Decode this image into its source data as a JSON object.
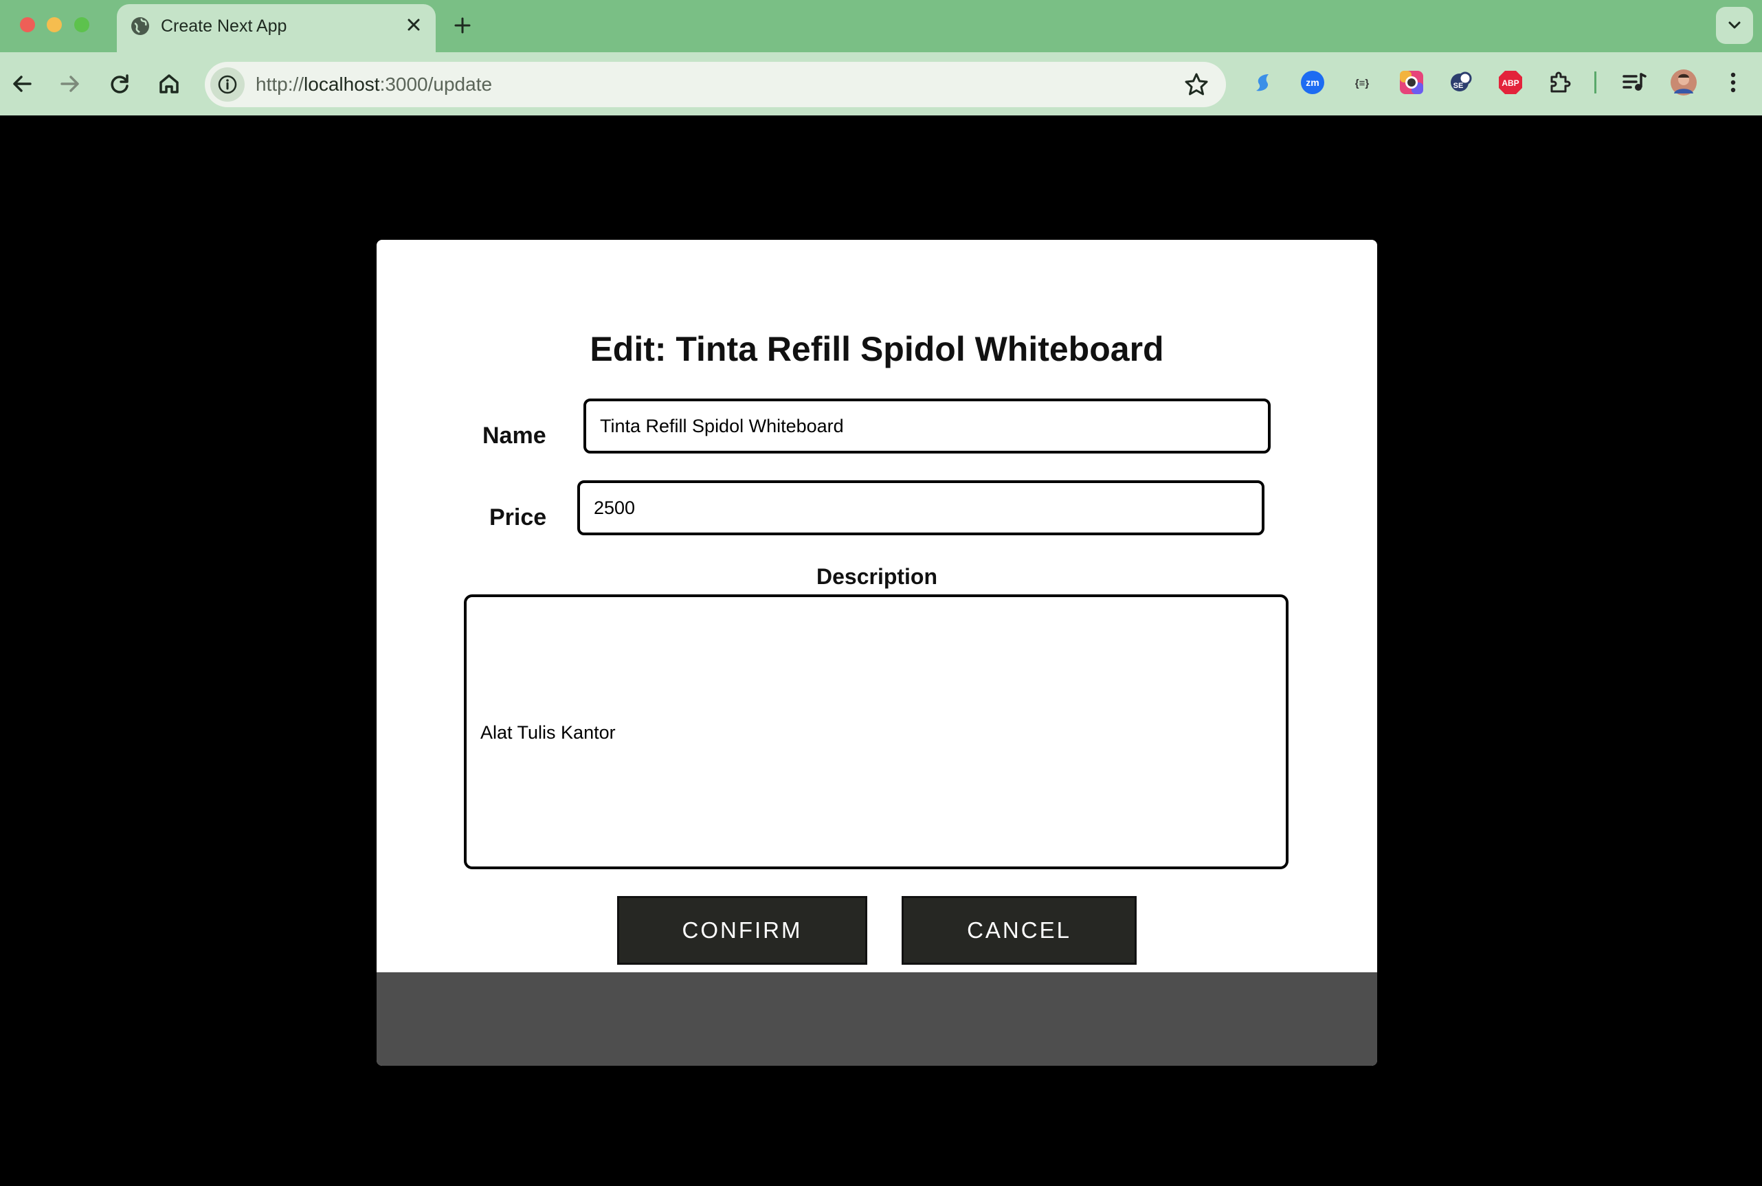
{
  "browser": {
    "tab": {
      "title": "Create Next App"
    },
    "address_bar": {
      "scheme": "http://",
      "host": "localhost",
      "rest": ":3000/update"
    },
    "extensions": [
      {
        "name": "swirl-extension-icon",
        "color": "#3b8fe8"
      },
      {
        "name": "zoom-extension-icon",
        "label": "zm",
        "color": "#1d6cf2"
      },
      {
        "name": "json-extension-icon",
        "label": "{≡}",
        "color": "#333333"
      },
      {
        "name": "color-picker-extension-icon",
        "color": "#e6447a"
      },
      {
        "name": "seo-extension-icon",
        "label": "SE",
        "color": "#2c3e6e"
      },
      {
        "name": "adblock-plus-icon",
        "label": "ABP",
        "color": "#e3233b"
      },
      {
        "name": "puzzle-extensions-icon",
        "color": "#222222"
      },
      {
        "name": "media-control-icon",
        "color": "#222222"
      },
      {
        "name": "profile-avatar",
        "color": "#c98a72"
      },
      {
        "name": "kebab-menu-icon",
        "color": "#222222"
      }
    ]
  },
  "modal": {
    "title": "Edit: Tinta Refill Spidol Whiteboard",
    "name_label": "Name",
    "name_value": "Tinta Refill Spidol Whiteboard",
    "price_label": "Price",
    "price_value": "2500",
    "description_label": "Description",
    "description_value": "Alat Tulis Kantor",
    "confirm_label": "CONFIRM",
    "cancel_label": "CANCEL"
  },
  "colors": {
    "tab_bar": "#7abf85",
    "toolbar": "#c5e3c8",
    "page_background": "#000000",
    "modal_footer": "#4e4e4e",
    "button_background": "#262723"
  }
}
